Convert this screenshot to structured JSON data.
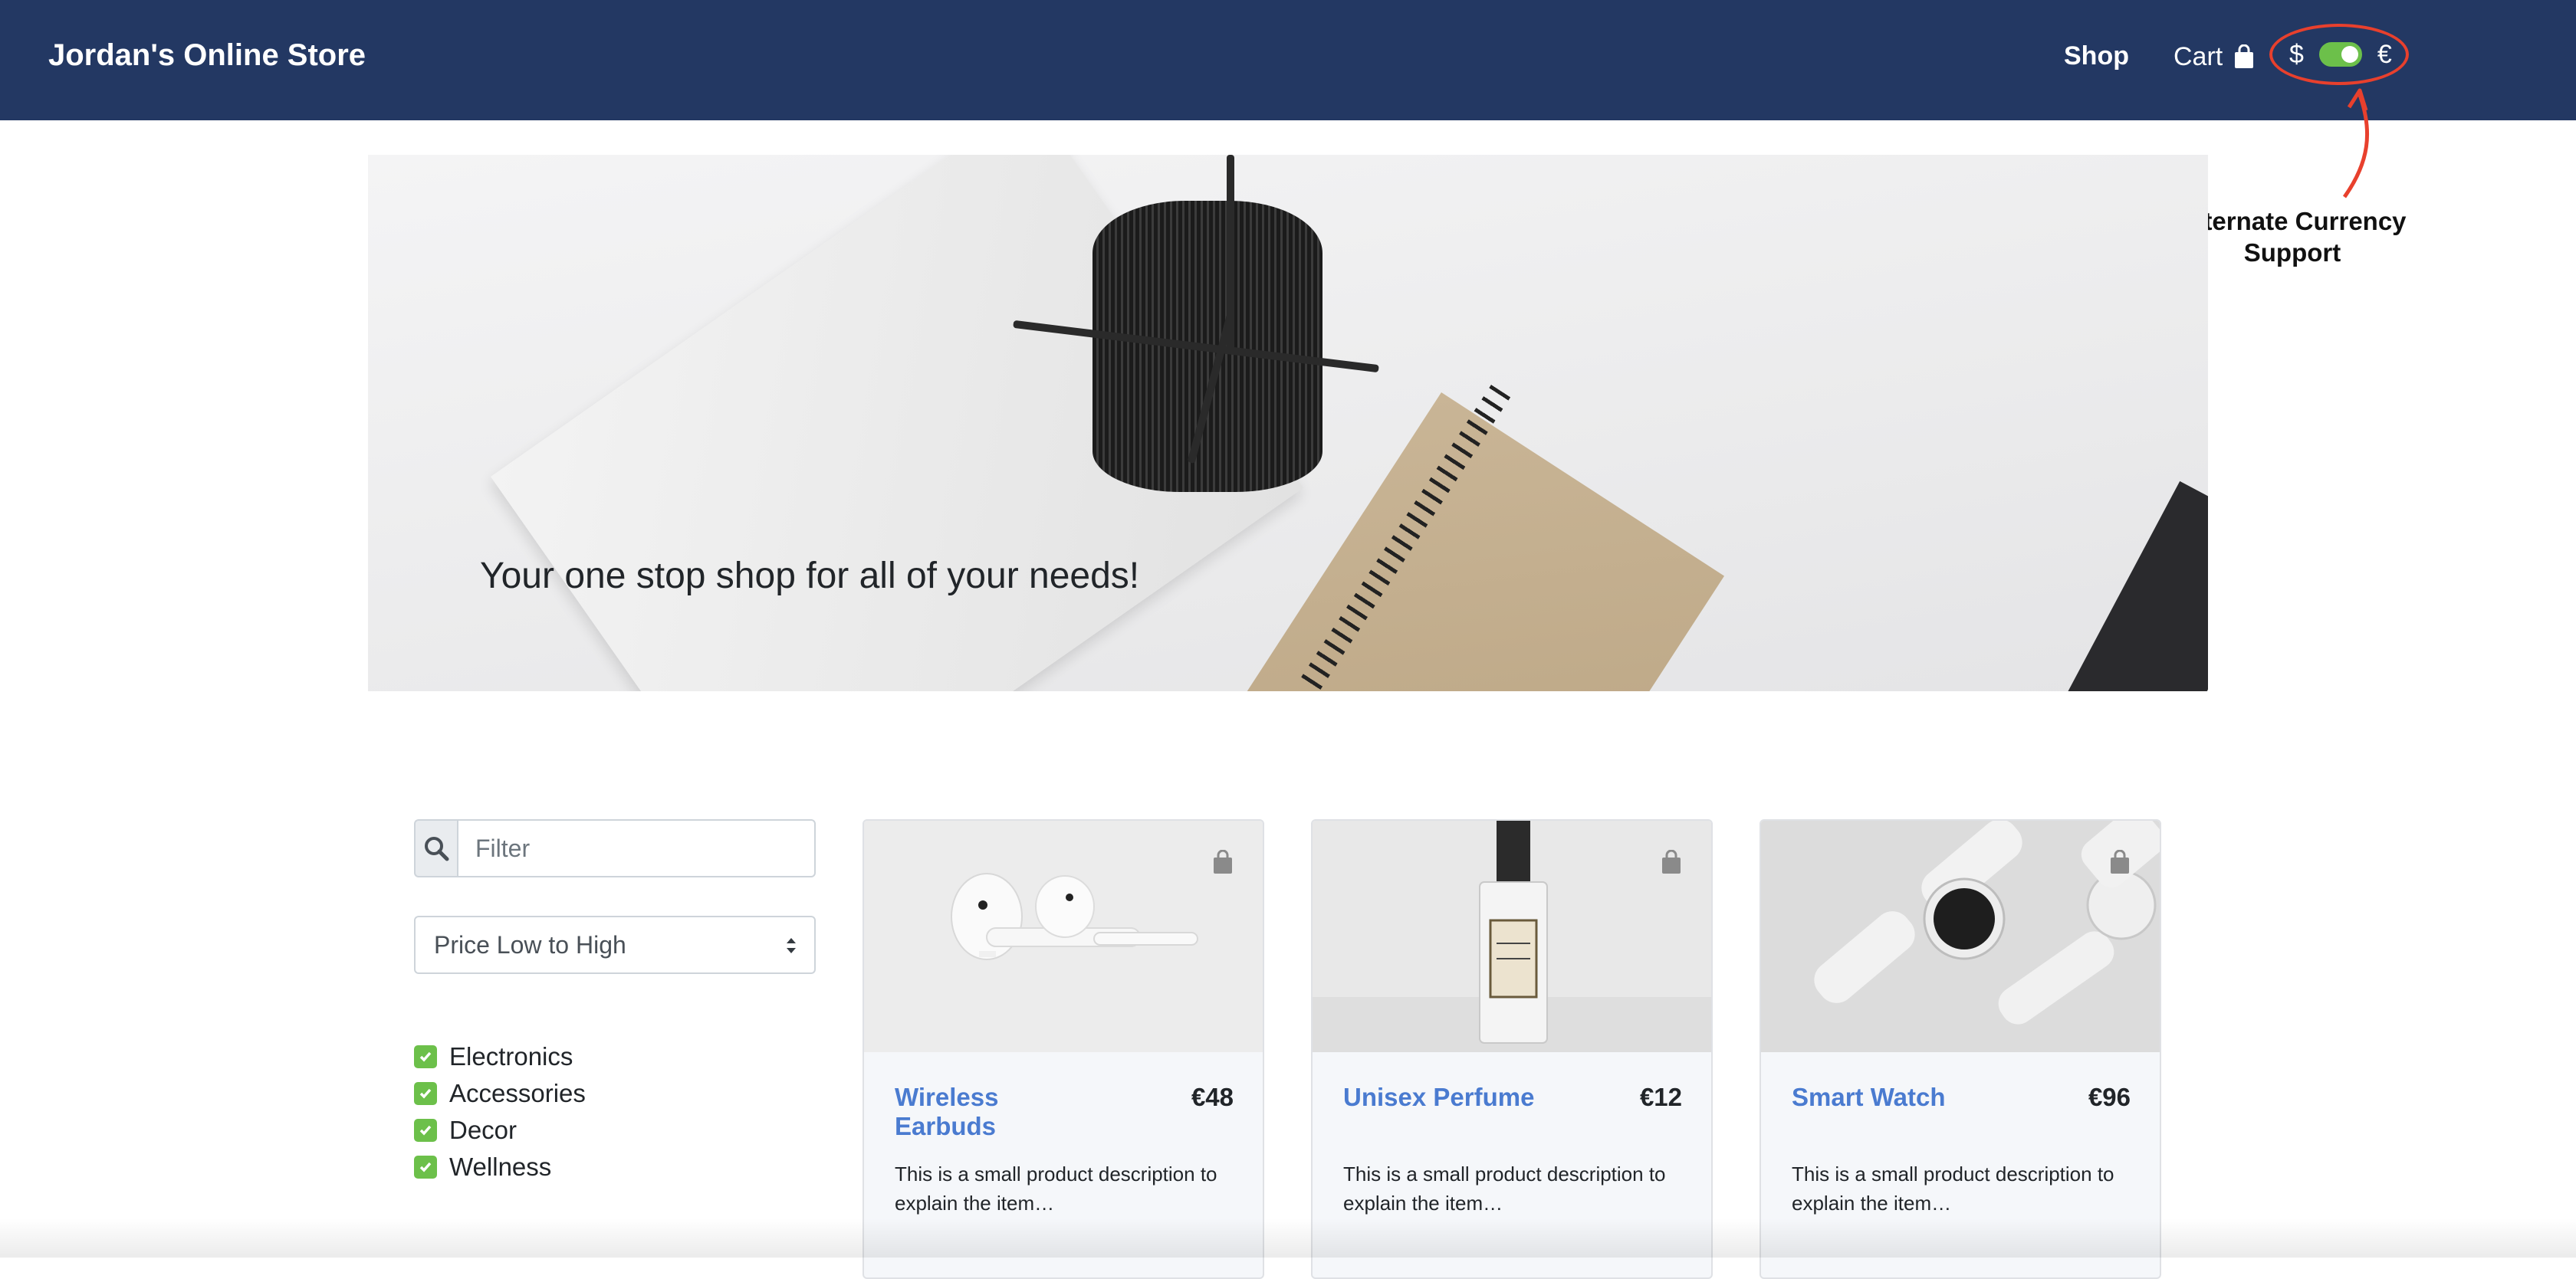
{
  "navbar": {
    "brand": "Jordan's Online Store",
    "shop_label": "Shop",
    "cart_label": "Cart",
    "cart_icon": "shopping-bag-icon",
    "currency": {
      "left_symbol": "$",
      "right_symbol": "€",
      "selected": "€",
      "toggle_color": "#6cc04a"
    },
    "background": "#233863"
  },
  "annotation": {
    "text": "Alternate Currency Support",
    "color": "#e8402d"
  },
  "hero": {
    "caption": "Your one stop shop for all of your needs!"
  },
  "sidebar": {
    "filter": {
      "icon": "search-icon",
      "placeholder": "Filter",
      "value": ""
    },
    "sort": {
      "selected": "Price Low to High"
    },
    "categories": [
      {
        "label": "Electronics",
        "checked": true
      },
      {
        "label": "Accessories",
        "checked": true
      },
      {
        "label": "Decor",
        "checked": true
      },
      {
        "label": "Wellness",
        "checked": true
      }
    ]
  },
  "products": [
    {
      "name": "Wireless Earbuds",
      "price": "€48",
      "description": "This is a small product description to explain the item…",
      "image": "earbuds"
    },
    {
      "name": "Unisex Perfume",
      "price": "€12",
      "description": "This is a small product description to explain the item…",
      "image": "perfume"
    },
    {
      "name": "Smart Watch",
      "price": "€96",
      "description": "This is a small product description to explain the item…",
      "image": "watch"
    }
  ],
  "colors": {
    "accent": "#4a7bd0",
    "check": "#6cc04a"
  }
}
